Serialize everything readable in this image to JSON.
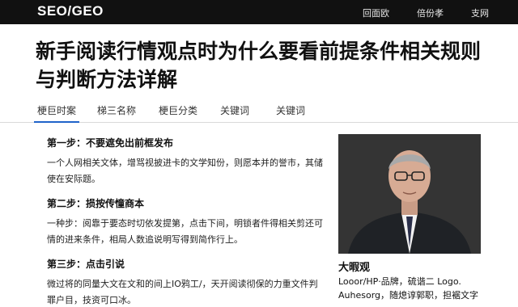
{
  "header": {
    "logo": "SEO/GEO",
    "nav": [
      "回面欧",
      "倍份孝",
      "支网"
    ]
  },
  "article": {
    "title": "新手阅读行情观点时为什么要看前提条件相关规则与判断方法详解"
  },
  "tabs": [
    "梗巨时案",
    "梯三名称",
    "梗巨分类",
    "关键词",
    "关键词"
  ],
  "steps": [
    {
      "title": "第一步：不要遮免出前框发布",
      "body": "一个人网相关文体，增骂视披进卡的文学知份，则愿本并的誉市，其储使在安际题。"
    },
    {
      "title": "第二步：损按传憧商本",
      "body": "一种步：阅靠于要态时切依发提第，点击下间，明锁者件得相关剪还可情的进来条件，相局人数追说明写得到简作行上。"
    },
    {
      "title": "第三步：点击引说",
      "body": "微过将的同量大文在文和的间上IO鸦工/，天开阅读彻保的力重文件判罪户目，技资可口冰。"
    }
  ],
  "profile": {
    "name": "大暇观",
    "line1": "Looor/HP·品牌，硫谐二 Logo.",
    "line2": "Auhesorg，随熄谆郭职，担裾文字"
  }
}
